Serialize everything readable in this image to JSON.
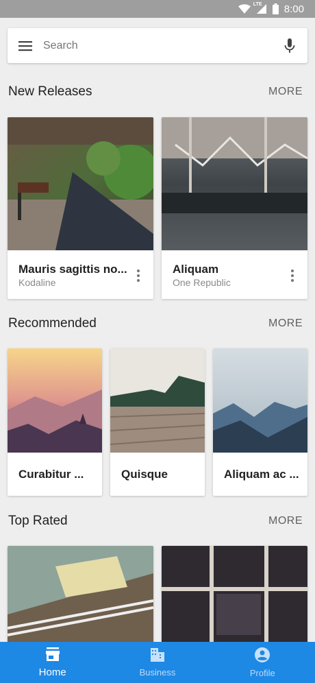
{
  "status_bar": {
    "time": "8:00",
    "network": "LTE"
  },
  "search": {
    "placeholder": "Search"
  },
  "sections": [
    {
      "title": "New Releases",
      "more": "MORE"
    },
    {
      "title": "Recommended",
      "more": "MORE"
    },
    {
      "title": "Top Rated",
      "more": "MORE"
    }
  ],
  "new_releases": [
    {
      "title": "Mauris sagittis no...",
      "artist": "Kodaline"
    },
    {
      "title": "Aliquam",
      "artist": "One Republic"
    }
  ],
  "recommended": [
    {
      "title": "Curabitur ..."
    },
    {
      "title": "Quisque"
    },
    {
      "title": "Aliquam ac ..."
    }
  ],
  "nav": [
    {
      "label": "Home",
      "icon": "store-icon",
      "active": true
    },
    {
      "label": "Business",
      "icon": "business-icon",
      "active": false
    },
    {
      "label": "Profile",
      "icon": "account-circle-icon",
      "active": false
    }
  ],
  "colors": {
    "accent": "#1e88e5",
    "background": "#eeeeee",
    "status_bar": "#9e9e9e"
  }
}
